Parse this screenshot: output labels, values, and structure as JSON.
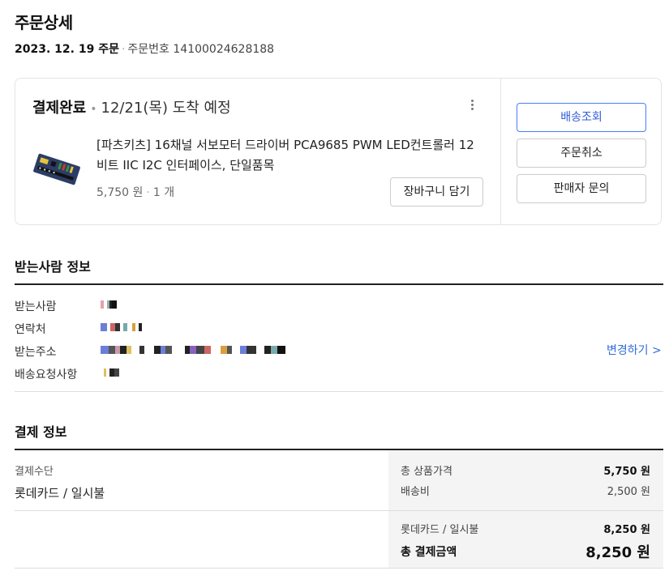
{
  "header": {
    "title": "주문상세",
    "order_date": "2023. 12. 19 주문",
    "order_number_label": "주문번호",
    "order_number": "14100024628188"
  },
  "order": {
    "status": "결제완료",
    "delivery": "12/21(목) 도착 예정",
    "product_name": "[파츠키츠] 16채널 서보모터 드라이버 PCA9685 PWM LED컨트롤러 12비트 IIC I2C 인터페이스, 단일품목",
    "price": "5,750 원",
    "quantity": "1 개",
    "cart_button": "장바구니 담기",
    "buttons": {
      "track": "배송조회",
      "cancel": "주문취소",
      "inquiry": "판매자 문의"
    }
  },
  "recipient": {
    "section_title": "받는사람 정보",
    "name_label": "받는사람",
    "phone_label": "연락처",
    "address_label": "받는주소",
    "request_label": "배송요청사항",
    "change_link": "변경하기 >"
  },
  "payment": {
    "section_title": "결제 정보",
    "method_label": "결제수단",
    "method": "롯데카드 / 일시불",
    "product_total_label": "총 상품가격",
    "product_total": "5,750 원",
    "shipping_label": "배송비",
    "shipping": "2,500 원",
    "card_label": "롯데카드 / 일시불",
    "card_amount": "8,250 원",
    "total_label": "총 결제금액",
    "total": "8,250 원"
  },
  "colors": {
    "accent": "#2f5bd7",
    "link": "#2f6fd6",
    "panel_bg": "#f4f4f4"
  }
}
